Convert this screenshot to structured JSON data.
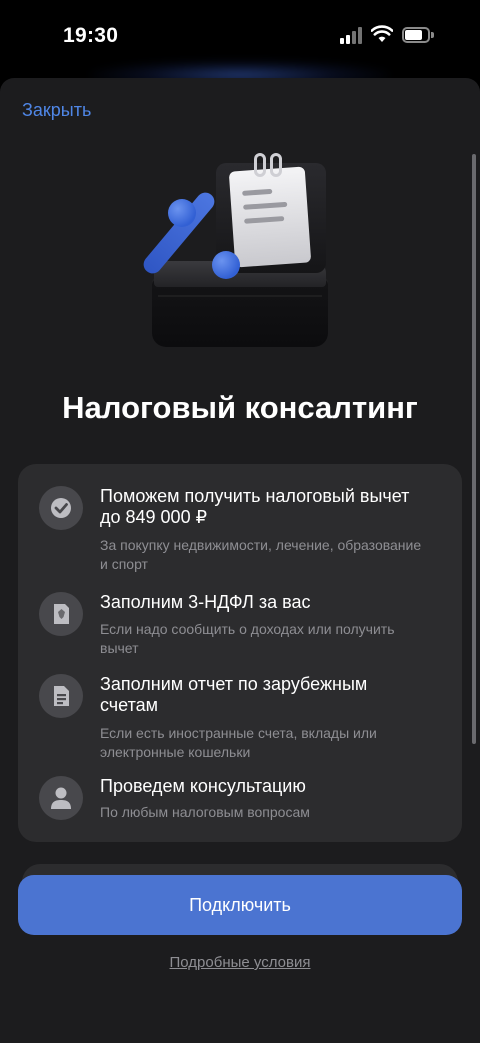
{
  "status_bar": {
    "time": "19:30",
    "icons": [
      "cellular-signal-icon",
      "wifi-icon",
      "battery-icon"
    ]
  },
  "sheet": {
    "close_label": "Закрыть",
    "illustration": "percent-clipboard-icon",
    "title": "Налоговый консалтинг",
    "features": [
      {
        "icon": "checkmark-icon",
        "title": "Поможем получить налоговый вычет до 849 000 ₽",
        "subtitle": "За покупку недвижимости, лечение, образование и спорт"
      },
      {
        "icon": "emblem-document-icon",
        "title": "Заполним 3-НДФЛ за вас",
        "subtitle": "Если надо сообщить о доходах или получить вычет"
      },
      {
        "icon": "document-lines-icon",
        "title": "Заполним отчет по зарубежным счетам",
        "subtitle": "Если есть иностранные счета, вклады или электронные кошельки"
      },
      {
        "icon": "consultant-person-icon",
        "title": "Проведем консультацию",
        "subtitle": "По любым налоговым вопросам"
      }
    ],
    "connect_label": "Подключить",
    "terms_label": "Подробные условия"
  },
  "colors": {
    "accent": "#4b74d1",
    "link": "#4f86e6",
    "sheet_bg": "#1c1c1e",
    "card_bg": "#2c2c2e",
    "secondary_text": "#8e8e93"
  }
}
